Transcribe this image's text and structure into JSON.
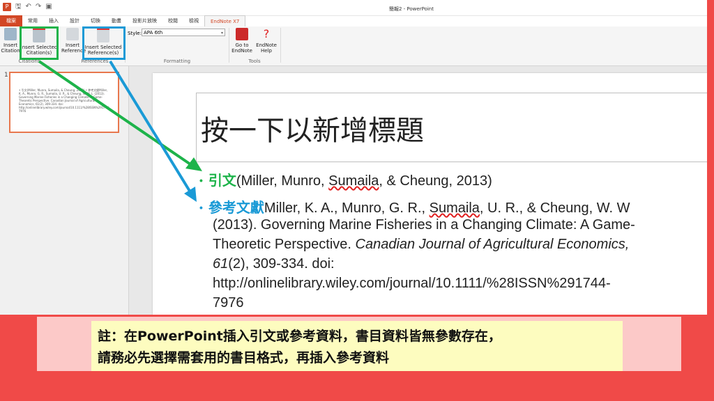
{
  "window": {
    "title": "簡報2 - PowerPoint",
    "qat": {
      "save": "🖫",
      "undo": "↶",
      "redo": "↷",
      "present": "▣"
    }
  },
  "tabs": [
    "檔案",
    "常用",
    "插入",
    "設計",
    "切換",
    "動畫",
    "投影片放映",
    "校閱",
    "檢視",
    "EndNote X7"
  ],
  "ribbon": {
    "insert_citation": "Insert\nCitation",
    "insert_selected_citation": "Insert Selected\nCitation(s)",
    "insert_reference": "Insert\nReference",
    "insert_selected_reference": "Insert Selected\nReference(s)",
    "style_label": "Style:",
    "style_value": "APA 6th",
    "go_to_endnote": "Go to\nEndNote",
    "endnote_help": "EndNote\nHelp",
    "help_glyph": "?",
    "groups": {
      "citations": "Citations",
      "references": "References",
      "formatting": "Formatting",
      "tools": "Tools"
    }
  },
  "thumbnail": {
    "number": "1",
    "text": "• 引文(Miller, Munro, Sumaila, & Cheung, 2013) • 參考文獻Miller, K. A., Munro, G. R., Sumaila, U. R., & Cheung, W. W. L. (2013). Governing Marine Fisheries in a Changing Climate: A Game-Theoretic Perspective. Canadian Journal of Agricultural Economics, 61(2), 309-334. doi: http://onlinelibrary.wiley.com/journal/10.1111/%28ISSN%291744-7976"
  },
  "slide": {
    "title": "按一下以新增標題",
    "bullet1": {
      "label": "引文",
      "citation_prefix": "(Miller, Munro, ",
      "citation_squiggle": "Sumaila",
      "citation_suffix": ", & Cheung, 2013)"
    },
    "bullet2": {
      "label": "參考文獻",
      "line1_a": "Miller, K. A., Munro, G. R., ",
      "line1_squiggle": "Sumaila",
      "line1_b": ", U. R., & Cheung, W. W",
      "line2": "(2013). Governing Marine Fisheries in a Changing Climate: A Game-",
      "line3_a": "Theoretic Perspective. ",
      "line3_italic": "Canadian Journal of Agricultural Economics,",
      "line4_italic": "61",
      "line4_b": "(2), 309-334. doi:",
      "line5": "http://onlinelibrary.wiley.com/journal/10.1111/%28ISSN%291744-",
      "line6": "7976"
    }
  },
  "note": {
    "line1": "註：在PowerPoint插入引文或參考資料，書目資料皆無參數存在，",
    "line2": "請務必先選擇需套用的書目格式，再插入參考資料"
  },
  "colors": {
    "green": "#1db34a",
    "blue": "#1a9ad6",
    "accent": "#d24726",
    "background": "#f04a48"
  }
}
